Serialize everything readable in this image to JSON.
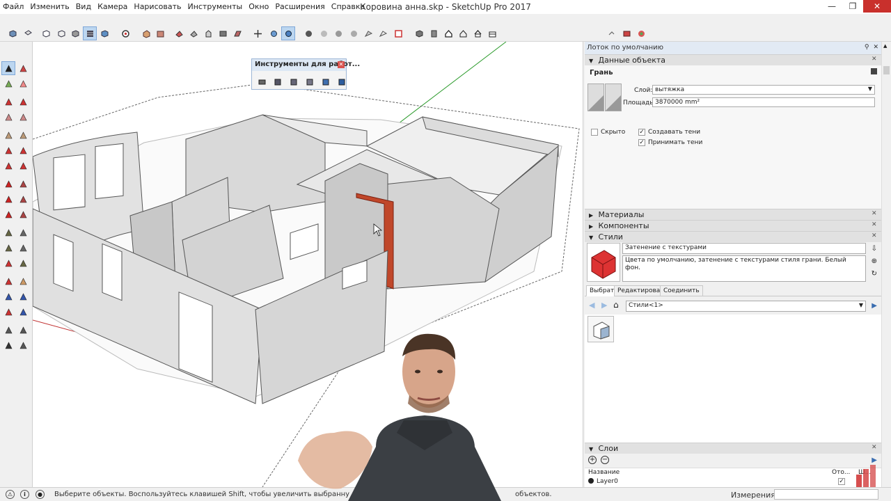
{
  "window": {
    "title": "Коровина анна.skp - SketchUp Pro 2017",
    "minimize": "—",
    "maximize": "❐",
    "close": "✕"
  },
  "menu": [
    "Файл",
    "Изменить",
    "Вид",
    "Камера",
    "Нарисовать",
    "Инструменты",
    "Окно",
    "Расширения",
    "Справка"
  ],
  "floating_toolbar": {
    "title": "Инструменты для работ...",
    "close": "✕"
  },
  "tray": {
    "title": "Лоток по умолчанию",
    "pin_icon": "pin-icon",
    "entity_info": {
      "header": "Данные объекта",
      "type": "Грань",
      "layer_label": "Слой:",
      "layer_value": "вытяжка",
      "area_label": "Площадь:",
      "area_value": "3870000 mm²",
      "hidden_label": "Скрыто",
      "cast_shadows_label": "Создавать тени",
      "receive_shadows_label": "Принимать тени",
      "hidden_checked": false,
      "cast_shadows_checked": true,
      "receive_shadows_checked": true
    },
    "materials_header": "Материалы",
    "components_header": "Компоненты",
    "styles": {
      "header": "Стили",
      "style_name": "Затенение с текстурами",
      "style_description": "Цвета по умолчанию, затенение с текстурами стиля грани. Белый фон.",
      "tabs": [
        "Выбрать",
        "Редактировать",
        "Соединить"
      ],
      "selected_tab": "Выбрать",
      "collection": "Стили<1>"
    },
    "layers": {
      "header": "Слои",
      "col_name": "Название",
      "col_visible": "Ото...",
      "col_color": "Ш...",
      "rows": [
        {
          "name": "Layer0",
          "visible": true
        }
      ]
    }
  },
  "status": {
    "hint": "Выберите объекты. Воспользуйтесь клавишей Shift, чтобы увеличить выбранну",
    "hint_tail": "объектов.",
    "measurements_label": "Измерения",
    "measurements_value": ""
  },
  "colors": {
    "accent_selected": "#bcd6f0",
    "tray_title": "#e2eaf4",
    "close_red": "#c9302c",
    "selected_face": "#c0472a",
    "wall_face": "#d8d8d8"
  }
}
